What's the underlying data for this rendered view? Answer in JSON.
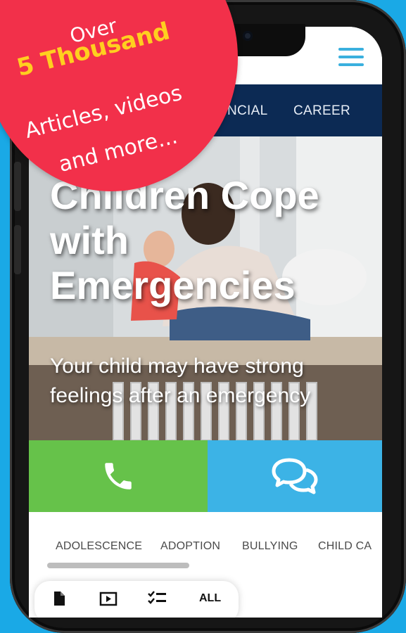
{
  "promo": {
    "line1": "Over",
    "line2": "5 Thousand",
    "line3": "Articles, videos",
    "line4": "and more..."
  },
  "nav": {
    "items": [
      {
        "label": "NCIAL"
      },
      {
        "label": "CAREER"
      }
    ]
  },
  "hero": {
    "title_line1": "Children Cope",
    "title_line2": "with",
    "title_line3": "Emergencies",
    "subtitle": "Your child may have strong feelings after an emergency"
  },
  "categories": {
    "items": [
      {
        "label": "ADOLESCENCE"
      },
      {
        "label": "ADOPTION"
      },
      {
        "label": "BULLYING"
      },
      {
        "label": "CHILD CA"
      }
    ],
    "scroll_progress": 0.44
  },
  "filters": {
    "all_label": "ALL"
  },
  "colors": {
    "background": "#1aa9e6",
    "nav": "#0c2a54",
    "call": "#66c24a",
    "chat": "#3cb3e6",
    "badge": "#f2304a",
    "badge_highlight": "#ffcf1f"
  },
  "icons": {
    "menu": "hamburger-icon",
    "call": "phone-icon",
    "chat": "chat-bubbles-icon",
    "article": "document-icon",
    "video": "video-play-icon",
    "checklist": "checklist-icon"
  }
}
